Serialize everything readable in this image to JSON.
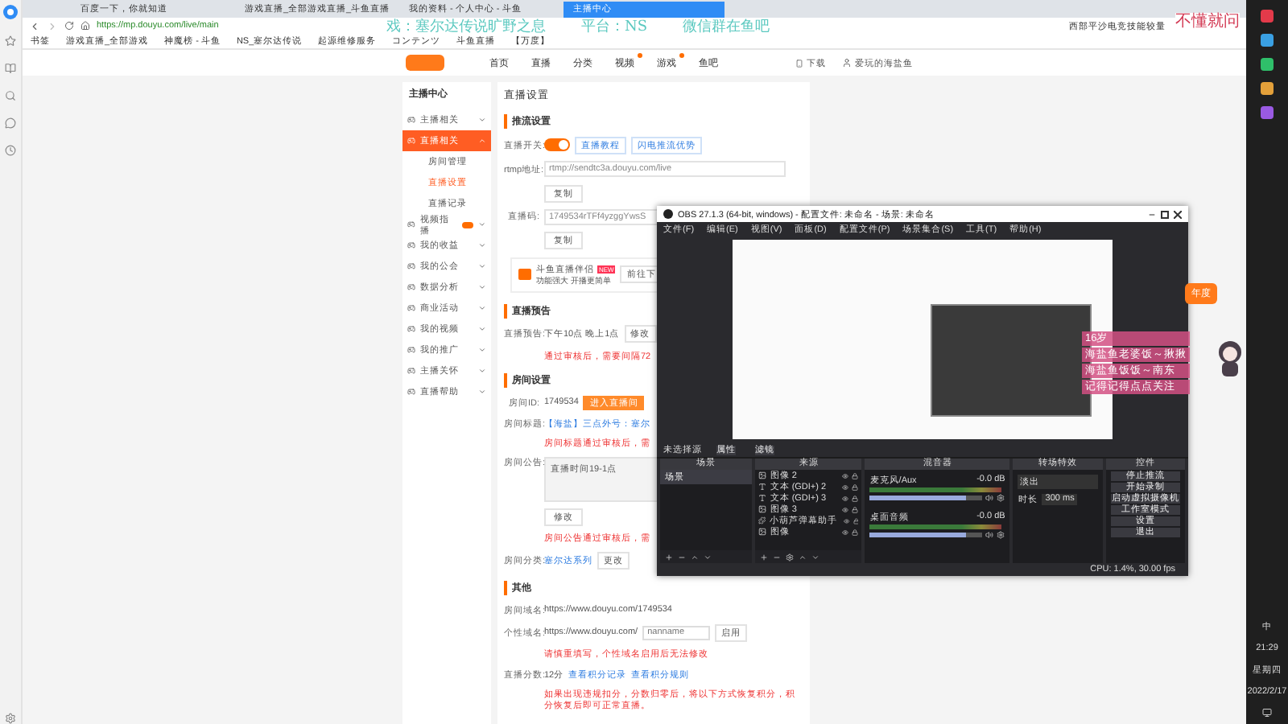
{
  "browser": {
    "tabs": [
      {
        "label": "百度一下，你就知道",
        "selected": false
      },
      {
        "label": "游戏直播_全部游戏直播_斗鱼直播",
        "selected": false
      },
      {
        "label": "我的资料 - 个人中心 - 斗鱼",
        "selected": false
      },
      {
        "label": "主播中心",
        "selected": true
      }
    ],
    "url": "https://mp.douyu.com/live/main",
    "bookmarks": [
      "书签",
      "游戏直播_全部游戏",
      "神魔榜 - 斗鱼",
      "NS_塞尔达传说",
      "起源维修服务",
      "コンテンツ",
      "斗鱼直播",
      "【万度】"
    ],
    "extension_text": "西部平沙电竞技能较量"
  },
  "overlay": {
    "top": [
      "戏：塞尔达传说旷野之息",
      "平台：NS",
      "微信群在鱼吧"
    ],
    "corner": "不懂就问",
    "side_lines": [
      "16岁",
      "海盐鱼老婆饭～揪揪",
      "海盐鱼饭饭～南东",
      "记得记得点点关注"
    ],
    "tag": "年度"
  },
  "site": {
    "nav": [
      {
        "label": "首页",
        "badge": false
      },
      {
        "label": "直播",
        "badge": false
      },
      {
        "label": "分类",
        "badge": false
      },
      {
        "label": "视频",
        "badge": true
      },
      {
        "label": "游戏",
        "badge": true
      },
      {
        "label": "鱼吧",
        "badge": false
      }
    ],
    "download": "下载",
    "user": "爱玩的海盐鱼"
  },
  "menu": {
    "title": "主播中心",
    "items": [
      {
        "label": "主播相关",
        "selected": false,
        "expanded": false,
        "badge": false
      },
      {
        "label": "直播相关",
        "selected": true,
        "expanded": true,
        "badge": false,
        "children": [
          {
            "label": "房间管理",
            "selected": false
          },
          {
            "label": "直播设置",
            "selected": true
          },
          {
            "label": "直播记录",
            "selected": false
          }
        ]
      },
      {
        "label": "视频指播",
        "selected": false,
        "expanded": false,
        "badge": true
      },
      {
        "label": "我的收益",
        "selected": false,
        "expanded": false,
        "badge": false
      },
      {
        "label": "我的公会",
        "selected": false,
        "expanded": false,
        "badge": false
      },
      {
        "label": "数据分析",
        "selected": false,
        "expanded": false,
        "badge": false
      },
      {
        "label": "商业活动",
        "selected": false,
        "expanded": false,
        "badge": false
      },
      {
        "label": "我的视频",
        "selected": false,
        "expanded": false,
        "badge": false
      },
      {
        "label": "我的推广",
        "selected": false,
        "expanded": false,
        "badge": false
      },
      {
        "label": "主播关怀",
        "selected": false,
        "expanded": false,
        "badge": false
      },
      {
        "label": "直播帮助",
        "selected": false,
        "expanded": false,
        "badge": false
      }
    ]
  },
  "settings": {
    "title": "直播设置",
    "push": {
      "heading": "推流设置",
      "switch_label": "直播开关:",
      "switch_on": true,
      "links": [
        "直播教程",
        "闪电推流优势"
      ],
      "rtmp_label": "rtmp地址:",
      "rtmp_value": "rtmp://sendtc3a.douyu.com/live",
      "copy": "复制",
      "code_label": "直播码:",
      "code_value": "1749534rTFf4yzggYwsS",
      "copy2": "复制",
      "promo_title": "斗鱼直播伴侣",
      "promo_badge": "NEW",
      "promo_subtitle": "功能强大 开播更简单",
      "promo_button": "前往下"
    },
    "preview": {
      "heading": "直播预告",
      "label": "直播预告:",
      "value": "下午10点 晚上1点",
      "button": "修改",
      "note": "通过审核后，需要间隔72"
    },
    "room": {
      "heading": "房间设置",
      "id_label": "房间ID:",
      "id_value": "1749534",
      "enter": "进入直播间",
      "title_label": "房间标题:",
      "title_value": "【海盐】三点外号：塞尔",
      "title_note": "房间标题通过审核后，需",
      "notice_label": "房间公告:",
      "notice_value": "直播时间19-1点",
      "modify": "修改",
      "notice_note": "房间公告通过审核后，需",
      "cat_label": "房间分类:",
      "cat_value": "塞尔达系列",
      "cat_button": "更改"
    },
    "other": {
      "heading": "其他",
      "domain_label": "房间域名:",
      "domain_value": "https://www.douyu.com/1749534",
      "custom_label": "个性域名:",
      "custom_prefix": "https://www.douyu.com/",
      "custom_placeholder": "nanname",
      "custom_button": "启用",
      "custom_note": "请慎重填写，个性域名启用后无法修改",
      "score_label": "直播分数:",
      "score_value": "12分",
      "score_links": [
        "查看积分记录",
        "查看积分规则"
      ],
      "score_note": "如果出现违规扣分，分数归零后，将以下方式恢复积分，积分恢复后即可正常直播。"
    }
  },
  "obs": {
    "title": "OBS 27.1.3 (64-bit, windows) - 配置文件: 未命名 - 场景: 未命名",
    "menu": [
      "文件(F)",
      "编辑(E)",
      "视图(V)",
      "面板(D)",
      "配置文件(P)",
      "场景集合(S)",
      "工具(T)",
      "帮助(H)"
    ],
    "source_bar": {
      "label": "未选择源",
      "buttons": [
        "属性",
        "滤镜"
      ]
    },
    "scenes": {
      "title": "场景",
      "items": [
        {
          "label": "场景",
          "selected": true
        }
      ]
    },
    "sources": {
      "title": "来源",
      "items": [
        {
          "label": "图像 2",
          "kind": "image"
        },
        {
          "label": "文本 (GDI+) 2",
          "kind": "text"
        },
        {
          "label": "文本 (GDI+) 3",
          "kind": "text"
        },
        {
          "label": "图像 3",
          "kind": "image"
        },
        {
          "label": "小葫芦弹幕助手",
          "kind": "plugin"
        },
        {
          "label": "图像",
          "kind": "image"
        }
      ]
    },
    "mixer": {
      "title": "混音器",
      "channels": [
        {
          "name": "麦克风/Aux",
          "reading": "-0.0 dB",
          "level": 0.85
        },
        {
          "name": "桌面音频",
          "reading": "-0.0 dB",
          "level": 0.85
        }
      ]
    },
    "transitions": {
      "title": "转场特效",
      "type": "淡出",
      "duration_label": "时长",
      "duration": "300 ms"
    },
    "controls": {
      "title": "控件",
      "buttons": [
        "停止推流",
        "开始录制",
        "启动虚拟摄像机",
        "工作室模式",
        "设置",
        "退出"
      ]
    },
    "status": "CPU: 1.4%, 30.00 fps"
  },
  "taskbar": {
    "ime": "中",
    "time": "21:29",
    "weekday": "星期四",
    "date": "2022/2/17"
  }
}
